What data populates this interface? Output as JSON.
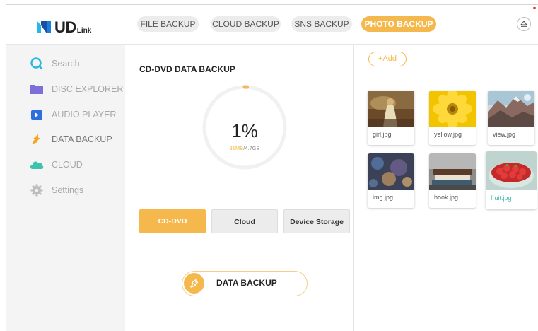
{
  "brand": {
    "logo_text": "UD",
    "logo_sub": "Link"
  },
  "tabs": [
    {
      "label": "FILE BACKUP",
      "active": false
    },
    {
      "label": "CLOUD BACKUP",
      "active": false
    },
    {
      "label": "SNS BACKUP",
      "active": false
    },
    {
      "label": "PHOTO BACKUP",
      "active": true
    }
  ],
  "header_icons": {
    "eject": "eject-icon"
  },
  "sidebar": {
    "items": [
      {
        "label": "Search",
        "icon": "search-icon"
      },
      {
        "label": "DISC EXPLORER",
        "icon": "folder-icon"
      },
      {
        "label": "AUDIO PLAYER",
        "icon": "play-icon"
      },
      {
        "label": "DATA BACKUP",
        "icon": "backup-arrow-icon",
        "active": true
      },
      {
        "label": "CLOUD",
        "icon": "cloud-icon"
      },
      {
        "label": "Settings",
        "icon": "gear-icon"
      }
    ]
  },
  "backup": {
    "title": "CD-DVD  DATA BACKUP",
    "percent_text": "1%",
    "progress": 0.01,
    "capacity_used": "31MB",
    "capacity_total": "/4.7GB",
    "targets": [
      {
        "label": "CD-DVD",
        "active": true
      },
      {
        "label": "Cloud",
        "active": false
      },
      {
        "label": "Device Storage",
        "active": false
      }
    ],
    "action_label": "DATA BACKUP"
  },
  "photos": {
    "add_label": "+Add",
    "items": [
      {
        "name": "girl.jpg",
        "subject": "girl-in-field"
      },
      {
        "name": "yellow.jpg",
        "subject": "yellow-flower"
      },
      {
        "name": "view.jpg",
        "subject": "mountain-view"
      },
      {
        "name": "img.jpg",
        "subject": "city-lights"
      },
      {
        "name": "book.jpg",
        "subject": "stack-of-books"
      },
      {
        "name": "fruit.jpg",
        "subject": "bowl-of-strawberries",
        "selected": true
      }
    ]
  },
  "colors": {
    "accent": "#f5b84c",
    "sidebar_bg": "#f4f4f4",
    "selected_text": "#3fb8a9",
    "ring_track": "#f1f1f1"
  }
}
